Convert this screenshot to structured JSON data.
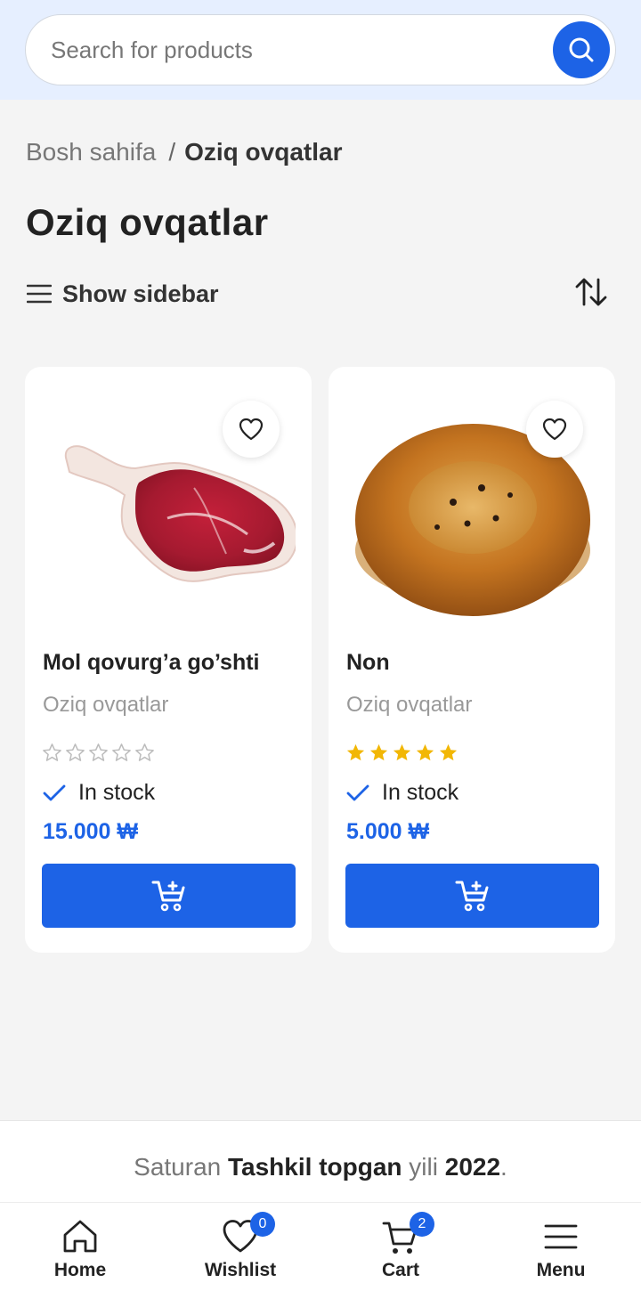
{
  "search": {
    "placeholder": "Search for products"
  },
  "breadcrumb": {
    "home": "Bosh sahifa",
    "separator": "/",
    "current": "Oziq ovqatlar"
  },
  "page_title": "Oziq ovqatlar",
  "toolbar": {
    "show_sidebar_label": "Show sidebar"
  },
  "products": [
    {
      "name": "Mol qovurg’a go’shti",
      "category": "Oziq ovqatlar",
      "rating": 0,
      "stock": "In stock",
      "price": "15.000 ₩",
      "image": "raw-beef-rib-steak"
    },
    {
      "name": "Non",
      "category": "Oziq ovqatlar",
      "rating": 5,
      "stock": "In stock",
      "price": "5.000 ₩",
      "image": "uzbek-round-bread"
    }
  ],
  "footer": {
    "brand": "Saturan",
    "founded_label": "Tashkil topgan",
    "year_word": "yili",
    "year": "2022",
    "period": "."
  },
  "bottom_nav": [
    {
      "label": "Home",
      "icon": "home-icon"
    },
    {
      "label": "Wishlist",
      "icon": "heart-icon",
      "badge": "0"
    },
    {
      "label": "Cart",
      "icon": "cart-icon",
      "badge": "2"
    },
    {
      "label": "Menu",
      "icon": "menu-icon"
    }
  ],
  "colors": {
    "accent": "#1d63e6",
    "star": "#f2b705",
    "header_bg": "#e6efff"
  }
}
